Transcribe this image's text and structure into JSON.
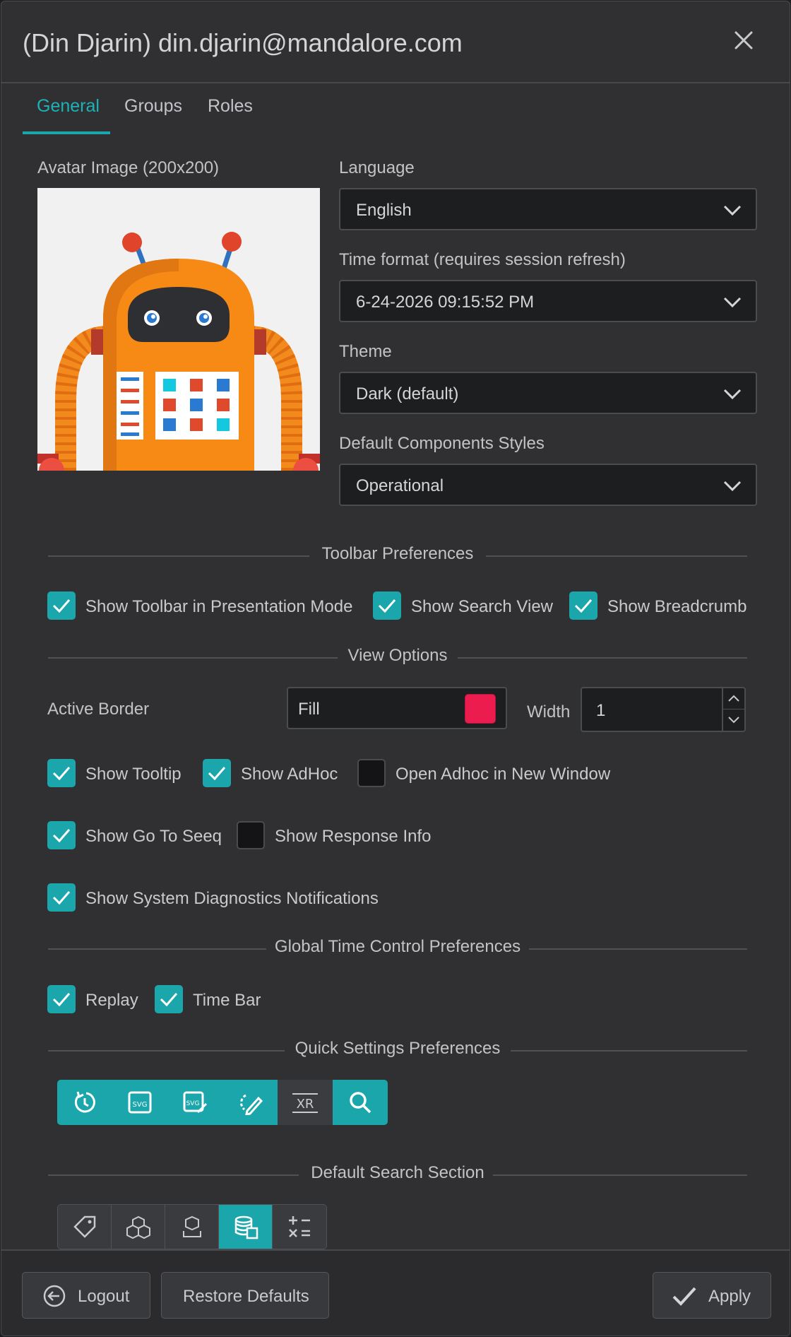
{
  "dialog": {
    "title": "(Din Djarin) din.djarin@mandalore.com"
  },
  "tabs": [
    {
      "label": "General"
    },
    {
      "label": "Groups"
    },
    {
      "label": "Roles"
    }
  ],
  "avatar": {
    "label": "Avatar Image (200x200)"
  },
  "language": {
    "label": "Language",
    "value": "English"
  },
  "time_format": {
    "label": "Time format (requires session refresh)",
    "value": "6-24-2026 09:15:52 PM"
  },
  "theme": {
    "label": "Theme",
    "value": "Dark (default)"
  },
  "component_styles": {
    "label": "Default Components Styles",
    "value": "Operational"
  },
  "sections": {
    "toolbar": "Toolbar Preferences",
    "view": "View Options",
    "time_control": "Global Time Control Preferences",
    "quick": "Quick Settings Preferences",
    "search": "Default Search Section"
  },
  "toolbar_prefs": [
    {
      "label": "Show Toolbar in Presentation Mode",
      "checked": true
    },
    {
      "label": "Show Search View",
      "checked": true
    },
    {
      "label": "Show Breadcrumb",
      "checked": true
    }
  ],
  "active_border": {
    "label": "Active Border",
    "fill_value": "Fill",
    "fill_color": "#ec1c4f",
    "width_label": "Width",
    "width_value": "1"
  },
  "view_options": [
    {
      "label": "Show Tooltip",
      "checked": true
    },
    {
      "label": "Show AdHoc",
      "checked": true
    },
    {
      "label": "Open Adhoc in New Window",
      "checked": false
    },
    {
      "label": "Show Go To Seeq",
      "checked": true
    },
    {
      "label": "Show Response Info",
      "checked": false
    },
    {
      "label": "Show System Diagnostics Notifications",
      "checked": true
    }
  ],
  "time_control": [
    {
      "label": "Replay",
      "checked": true
    },
    {
      "label": "Time Bar",
      "checked": true
    }
  ],
  "quick_icons": [
    {
      "icon": "replay-icon",
      "active": true
    },
    {
      "icon": "svg-file-icon",
      "active": true
    },
    {
      "icon": "svg-edit-icon",
      "active": true
    },
    {
      "icon": "edit-mode-icon",
      "active": true
    },
    {
      "icon": "xr-icon",
      "active": false
    },
    {
      "icon": "search-icon",
      "active": true
    }
  ],
  "search_icons": [
    {
      "icon": "tag-icon",
      "active": false
    },
    {
      "icon": "cubes-icon",
      "active": false
    },
    {
      "icon": "asset-icon",
      "active": false
    },
    {
      "icon": "database-icon",
      "active": true
    },
    {
      "icon": "calculator-icon",
      "active": false
    }
  ],
  "footer": {
    "logout": "Logout",
    "restore": "Restore Defaults",
    "apply": "Apply"
  },
  "colors": {
    "accent": "#1aa6ab",
    "accent_text": "#1bb3b8",
    "background": "#303033",
    "input": "#1d1e20"
  }
}
